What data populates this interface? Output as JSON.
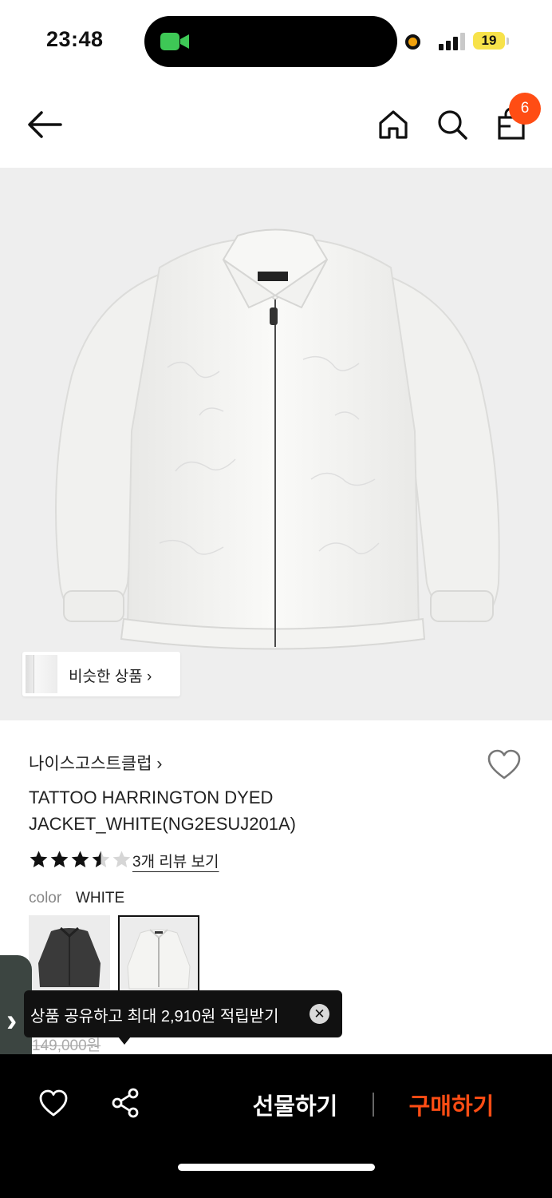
{
  "status_bar": {
    "time": "23:48",
    "battery": "19",
    "accent_color": "#3ec856"
  },
  "header": {
    "cart_count": "6",
    "badge_color": "#ff4d14"
  },
  "gallery": {
    "similar_label": "비슷한 상품 ›"
  },
  "product": {
    "brand": "나이스고스트클럽 ›",
    "title": "TATTOO HARRINGTON DYED JACKET_WHITE(NG2ESUJ201A)",
    "rating": 3.5,
    "rating_max": 5,
    "review_link": "3개 리뷰 보기",
    "color_label": "color",
    "color_value": "WHITE",
    "price_original": "149,000원"
  },
  "side_tab": {
    "icon": "chevron-right-icon"
  },
  "tooltip": {
    "text": "상품 공유하고 최대 2,910원 적립받기",
    "close": "✕"
  },
  "bottom_bar": {
    "gift_label": "선물하기",
    "buy_label": "구매하기",
    "buy_color": "#ff4d14"
  }
}
